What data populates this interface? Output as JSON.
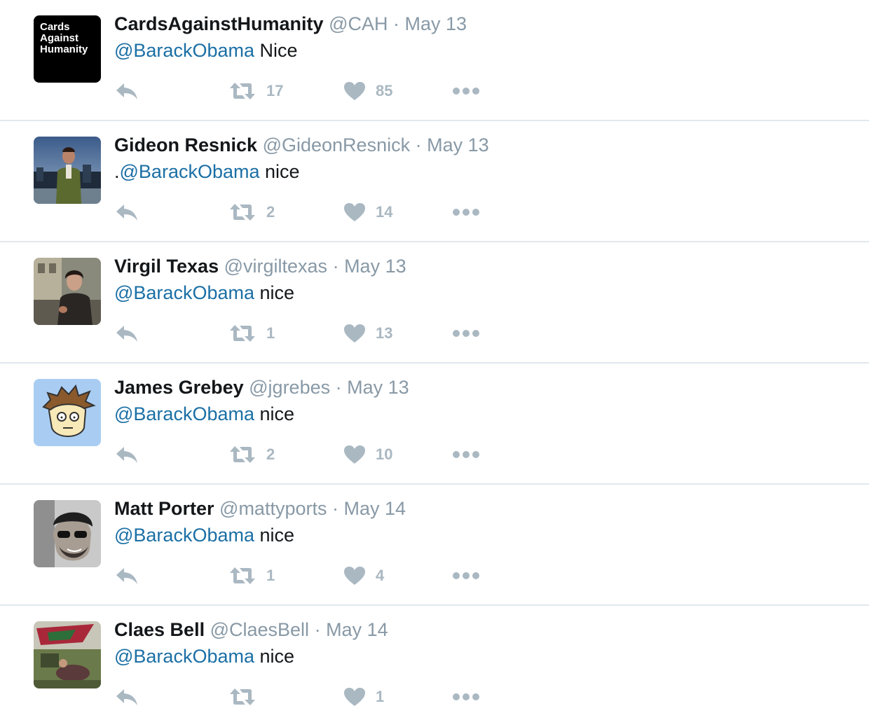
{
  "colors": {
    "mention": "#1b6fa5",
    "name": "#14171a",
    "meta": "#8899a6",
    "icon": "#aab8c2",
    "divider": "#e1e8ed"
  },
  "avatar_cah_text": [
    "Cards",
    "Against",
    "Humanity"
  ],
  "tweets": [
    {
      "name": "CardsAgainstHumanity",
      "handle": "@CAH",
      "date": "· May 13",
      "prefix": "",
      "mention": "@BarackObama",
      "text": " Nice",
      "retweets": "17",
      "likes": "85",
      "avatar": "cah-logo"
    },
    {
      "name": "Gideon Resnick",
      "handle": "@GideonResnick",
      "date": "· May 13",
      "prefix": ".",
      "mention": "@BarackObama",
      "text": " nice",
      "retweets": "2",
      "likes": "14",
      "avatar": "photo-man-city"
    },
    {
      "name": "Virgil Texas",
      "handle": "@virgiltexas",
      "date": "· May 13",
      "prefix": "",
      "mention": "@BarackObama",
      "text": " nice",
      "retweets": "1",
      "likes": "13",
      "avatar": "photo-man-street"
    },
    {
      "name": "James Grebey",
      "handle": "@jgrebes",
      "date": "· May 13",
      "prefix": "",
      "mention": "@BarackObama",
      "text": " nice",
      "retweets": "2",
      "likes": "10",
      "avatar": "cartoon-face"
    },
    {
      "name": "Matt Porter",
      "handle": "@mattyports",
      "date": "· May 14",
      "prefix": "",
      "mention": "@BarackObama",
      "text": " nice",
      "retweets": "1",
      "likes": "4",
      "avatar": "photo-man-sunglasses"
    },
    {
      "name": "Claes Bell",
      "handle": "@ClaesBell",
      "date": "· May 14",
      "prefix": "",
      "mention": "@BarackObama",
      "text": " nice",
      "retweets": "",
      "likes": "1",
      "avatar": "photo-outdoor-flag"
    }
  ],
  "icons": {
    "reply": "reply-icon",
    "retweet": "retweet-icon",
    "like": "heart-icon",
    "more": "more-dots-icon"
  }
}
